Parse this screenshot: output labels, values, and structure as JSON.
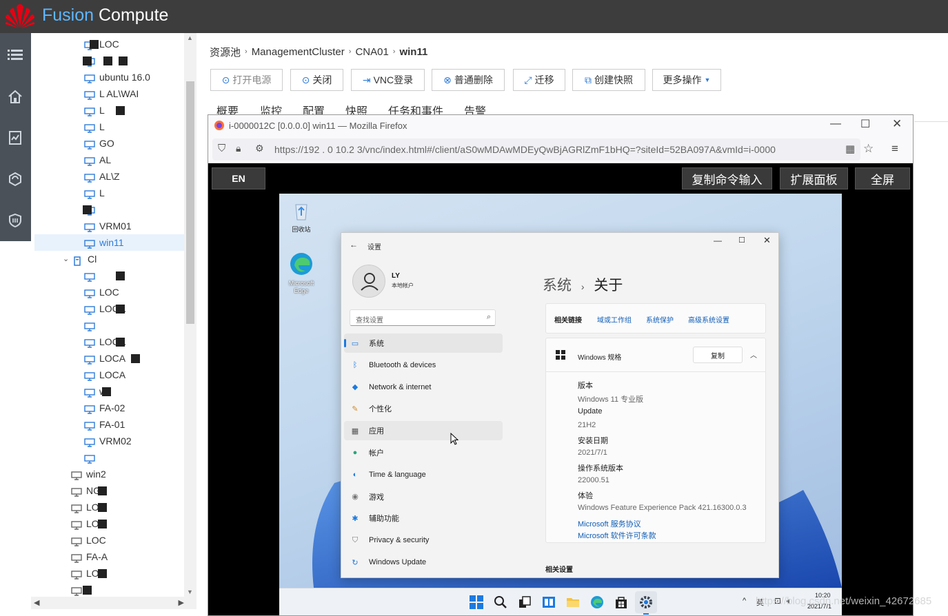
{
  "app": {
    "brand_part1": "Fusion",
    "brand_part2": "Compute"
  },
  "rail": {
    "icons": [
      "menu-icon",
      "home-icon",
      "monitor-icon",
      "resource-icon",
      "shield-icon"
    ]
  },
  "tree": {
    "items": [
      {
        "label": "LOC",
        "icon": "vm-icon"
      },
      {
        "label": "",
        "icon": "vm-icon"
      },
      {
        "label": "ubuntu 16.0",
        "icon": "vm-icon"
      },
      {
        "label": "L AL\\WAI",
        "icon": "vm-icon"
      },
      {
        "label": "L",
        "icon": "vm-icon"
      },
      {
        "label": "L",
        "icon": "vm-icon"
      },
      {
        "label": "GO",
        "icon": "vm-icon"
      },
      {
        "label": "AL",
        "icon": "vm-icon"
      },
      {
        "label": "AL\\Z",
        "icon": "vm-icon"
      },
      {
        "label": "L",
        "icon": "vm-icon"
      },
      {
        "label": "",
        "icon": "vm-icon"
      },
      {
        "label": "VRM01",
        "icon": "vm-icon"
      },
      {
        "label": "win11",
        "icon": "vm-icon",
        "selected": true
      },
      {
        "label": "Cl",
        "icon": "host-icon"
      },
      {
        "label": "",
        "icon": "vm-icon"
      },
      {
        "label": "LOC",
        "icon": "vm-icon"
      },
      {
        "label": "LOCA",
        "icon": "vm-icon"
      },
      {
        "label": "",
        "icon": "vm-icon"
      },
      {
        "label": "LOCA",
        "icon": "vm-icon"
      },
      {
        "label": "LOCA",
        "icon": "vm-icon"
      },
      {
        "label": "LOCA",
        "icon": "vm-icon"
      },
      {
        "label": "w",
        "icon": "vm-icon"
      },
      {
        "label": "FA-02",
        "icon": "vm-icon"
      },
      {
        "label": "FA-01",
        "icon": "vm-icon"
      },
      {
        "label": "VRM02",
        "icon": "vm-icon"
      },
      {
        "label": "",
        "icon": "vm-icon"
      },
      {
        "label": "win2",
        "icon": "vm-icon"
      },
      {
        "label": "NG",
        "icon": "vm-icon"
      },
      {
        "label": "LOC",
        "icon": "vm-icon"
      },
      {
        "label": "LOC",
        "icon": "vm-icon"
      },
      {
        "label": "LOC",
        "icon": "vm-icon"
      },
      {
        "label": "FA-A",
        "icon": "vm-icon"
      },
      {
        "label": "LOC",
        "icon": "vm-icon"
      },
      {
        "label": "",
        "icon": "vm-icon"
      }
    ]
  },
  "breadcrumb": {
    "items": [
      "资源池",
      "ManagementCluster",
      "CNA01"
    ],
    "current": "win11"
  },
  "toolbar": {
    "power_on": "打开电源",
    "shutdown": "关闭",
    "vnc_login": "VNC登录",
    "delete": "普通删除",
    "migrate": "迁移",
    "snapshot": "创建快照",
    "more": "更多操作"
  },
  "tabs": [
    "概要",
    "监控",
    "配置",
    "快照",
    "任务和事件",
    "告警"
  ],
  "firefox": {
    "title": "i-0000012C [0.0.0.0] win11 — Mozilla Firefox",
    "url": "https://192 . 0 10.2 3/vnc/index.html#/client/aS0wMDAwMDEyQwBjAGRlZmF1bHQ=?siteId=52BA097A&vmId=i-0000"
  },
  "vnc": {
    "lang": "EN",
    "copy_cmd": "复制命令输入",
    "expand": "扩展面板",
    "fullscreen": "全屏"
  },
  "desktop": {
    "icons": [
      {
        "label": "回收站",
        "icon": "recycle-bin-icon"
      },
      {
        "label": "Microsoft Edge",
        "icon": "edge-icon"
      }
    ]
  },
  "settings": {
    "title": "设置",
    "user_name": "LY",
    "user_type": "本地帐户",
    "search_placeholder": "查找设置",
    "nav": [
      {
        "label": "系统",
        "icon": "display-icon",
        "active": true
      },
      {
        "label": "Bluetooth & devices",
        "icon": "bluetooth-icon"
      },
      {
        "label": "Network & internet",
        "icon": "wifi-icon"
      },
      {
        "label": "个性化",
        "icon": "brush-icon"
      },
      {
        "label": "应用",
        "icon": "apps-icon",
        "hover": true
      },
      {
        "label": "帐户",
        "icon": "account-icon"
      },
      {
        "label": "Time & language",
        "icon": "globe-icon"
      },
      {
        "label": "游戏",
        "icon": "gamepad-icon"
      },
      {
        "label": "辅助功能",
        "icon": "accessibility-icon"
      },
      {
        "label": "Privacy & security",
        "icon": "shield-icon"
      },
      {
        "label": "Windows Update",
        "icon": "update-icon"
      }
    ],
    "heading_parent": "系统",
    "heading_current": "关于",
    "related_links": {
      "label": "相关链接",
      "links": [
        "域或工作组",
        "系统保护",
        "高级系统设置"
      ]
    },
    "spec": {
      "title": "Windows 规格",
      "copy_button": "复制",
      "rows": [
        {
          "key": "版本",
          "value": "Windows 11 专业版"
        },
        {
          "key": "Update",
          "value": "21H2"
        },
        {
          "key": "安装日期",
          "value": "2021/7/1"
        },
        {
          "key": "操作系统版本",
          "value": "22000.51"
        },
        {
          "key": "体验",
          "value": "Windows Feature Experience Pack 421.16300.0.3"
        }
      ],
      "links": [
        "Microsoft 服务协议",
        "Microsoft 软件许可条款"
      ]
    },
    "related_settings": "相关设置"
  },
  "taskbar": {
    "ime": "英",
    "time": "10:20",
    "date": "2021/7/1",
    "icons": [
      "start-icon",
      "search-icon",
      "task-view-icon",
      "widgets-icon",
      "explorer-icon",
      "edge-icon",
      "store-icon",
      "settings-icon"
    ]
  },
  "watermark": "https://blog.csdn.net/weixin_42672685"
}
